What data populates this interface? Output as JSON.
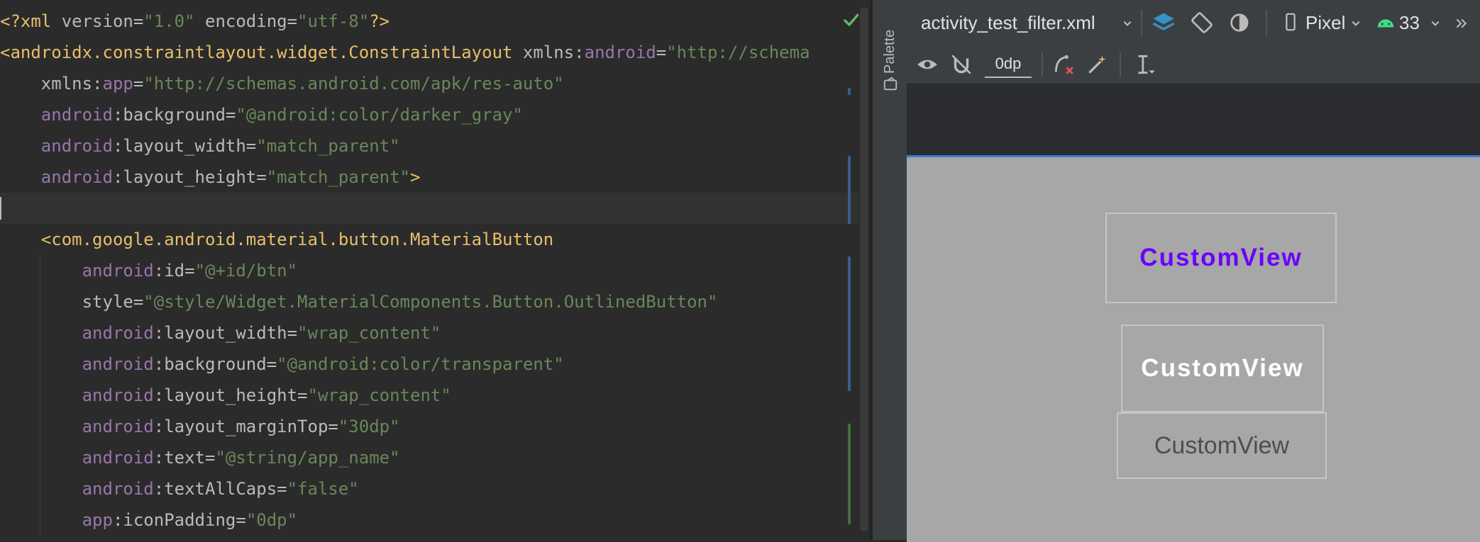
{
  "editor": {
    "lines": [
      [
        [
          "tag",
          "<?xml "
        ],
        [
          "attr",
          "version="
        ],
        [
          "val",
          "\"1.0\""
        ],
        [
          "attr",
          " encoding="
        ],
        [
          "val",
          "\"utf-8\""
        ],
        [
          "tag",
          "?>"
        ]
      ],
      [
        [
          "tag",
          "<androidx.constraintlayout.widget.ConstraintLayout "
        ],
        [
          "attr",
          "xmlns:"
        ],
        [
          "ns",
          "android"
        ],
        [
          "punct",
          "="
        ],
        [
          "val",
          "\"http://schema"
        ]
      ],
      [
        [
          "attr",
          "    xmlns:"
        ],
        [
          "ns",
          "app"
        ],
        [
          "punct",
          "="
        ],
        [
          "val",
          "\"http://schemas.android.com/apk/res-auto\""
        ]
      ],
      [
        [
          "ns",
          "    android"
        ],
        [
          "punct",
          ":"
        ],
        [
          "attr",
          "background"
        ],
        [
          "punct",
          "="
        ],
        [
          "val",
          "\"@android:color/darker_gray\""
        ]
      ],
      [
        [
          "ns",
          "    android"
        ],
        [
          "punct",
          ":"
        ],
        [
          "attr",
          "layout_width"
        ],
        [
          "punct",
          "="
        ],
        [
          "val",
          "\"match_parent\""
        ]
      ],
      [
        [
          "ns",
          "    android"
        ],
        [
          "punct",
          ":"
        ],
        [
          "attr",
          "layout_height"
        ],
        [
          "punct",
          "="
        ],
        [
          "val",
          "\"match_parent\""
        ],
        [
          "tag",
          ">"
        ]
      ],
      [],
      [
        [
          "tag",
          "    <com.google.android.material.button.MaterialButton"
        ]
      ],
      [
        [
          "ns",
          "        android"
        ],
        [
          "punct",
          ":"
        ],
        [
          "attr",
          "id"
        ],
        [
          "punct",
          "="
        ],
        [
          "val",
          "\"@+id/btn\""
        ]
      ],
      [
        [
          "attr",
          "        style"
        ],
        [
          "punct",
          "="
        ],
        [
          "val",
          "\"@style/Widget.MaterialComponents.Button.OutlinedButton\""
        ]
      ],
      [
        [
          "ns",
          "        android"
        ],
        [
          "punct",
          ":"
        ],
        [
          "attr",
          "layout_width"
        ],
        [
          "punct",
          "="
        ],
        [
          "val",
          "\"wrap_content\""
        ]
      ],
      [
        [
          "ns",
          "        android"
        ],
        [
          "punct",
          ":"
        ],
        [
          "attr",
          "background"
        ],
        [
          "punct",
          "="
        ],
        [
          "val",
          "\"@android:color/transparent\""
        ]
      ],
      [
        [
          "ns",
          "        android"
        ],
        [
          "punct",
          ":"
        ],
        [
          "attr",
          "layout_height"
        ],
        [
          "punct",
          "="
        ],
        [
          "val",
          "\"wrap_content\""
        ]
      ],
      [
        [
          "ns",
          "        android"
        ],
        [
          "punct",
          ":"
        ],
        [
          "attr",
          "layout_marginTop"
        ],
        [
          "punct",
          "="
        ],
        [
          "val",
          "\"30dp\""
        ]
      ],
      [
        [
          "ns",
          "        android"
        ],
        [
          "punct",
          ":"
        ],
        [
          "attr",
          "text"
        ],
        [
          "punct",
          "="
        ],
        [
          "val",
          "\"@string/app_name\""
        ]
      ],
      [
        [
          "ns",
          "        android"
        ],
        [
          "punct",
          ":"
        ],
        [
          "attr",
          "textAllCaps"
        ],
        [
          "punct",
          "="
        ],
        [
          "val",
          "\"false\""
        ]
      ],
      [
        [
          "ns",
          "        app"
        ],
        [
          "punct",
          ":"
        ],
        [
          "attr",
          "iconPadding"
        ],
        [
          "punct",
          "="
        ],
        [
          "val",
          "\"0dp\""
        ]
      ]
    ]
  },
  "palette": {
    "label": "Palette"
  },
  "design_toolbar": {
    "file_name": "activity_test_filter.xml",
    "device": "Pixel",
    "api_level": "33",
    "margin_value": "0dp"
  },
  "preview": {
    "buttons": [
      {
        "text": "CustomView"
      },
      {
        "text": "CustomView"
      },
      {
        "text": "CustomView"
      }
    ]
  },
  "colors": {
    "accent_purple": "#6b00ff",
    "preview_bg": "#a7a7a7",
    "selection_blue": "#3a7ad6"
  }
}
